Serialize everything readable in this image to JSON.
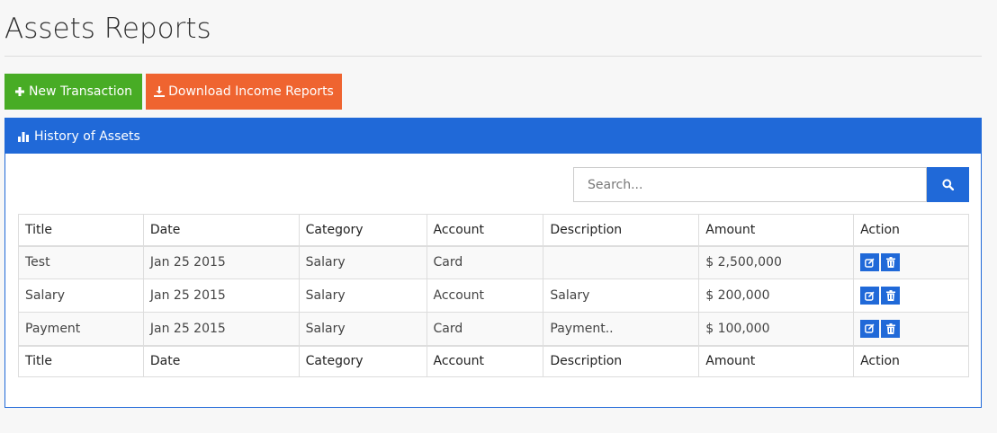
{
  "page": {
    "title": "Assets Reports"
  },
  "toolbar": {
    "new_label": "New Transaction",
    "download_label": "Download Income Reports"
  },
  "panel": {
    "title": "History of Assets"
  },
  "search": {
    "placeholder": "Search...",
    "value": ""
  },
  "table": {
    "columns": [
      "Title",
      "Date",
      "Category",
      "Account",
      "Description",
      "Amount",
      "Action"
    ],
    "rows": [
      {
        "title": "Test",
        "date": "Jan 25 2015",
        "category": "Salary",
        "account": "Card",
        "description": "",
        "amount": "$ 2,500,000"
      },
      {
        "title": "Salary",
        "date": "Jan 25 2015",
        "category": "Salary",
        "account": "Account",
        "description": "Salary",
        "amount": "$ 200,000"
      },
      {
        "title": "Payment",
        "date": "Jan 25 2015",
        "category": "Salary",
        "account": "Card",
        "description": "Payment..",
        "amount": "$ 100,000"
      }
    ]
  },
  "colors": {
    "green": "#48ac25",
    "orange": "#ef6430",
    "blue": "#2069d8"
  },
  "icons": {
    "new": "plus-icon",
    "download": "download-icon",
    "panel": "bar-chart-icon",
    "search": "search-icon",
    "edit": "edit-icon",
    "delete": "trash-icon"
  }
}
